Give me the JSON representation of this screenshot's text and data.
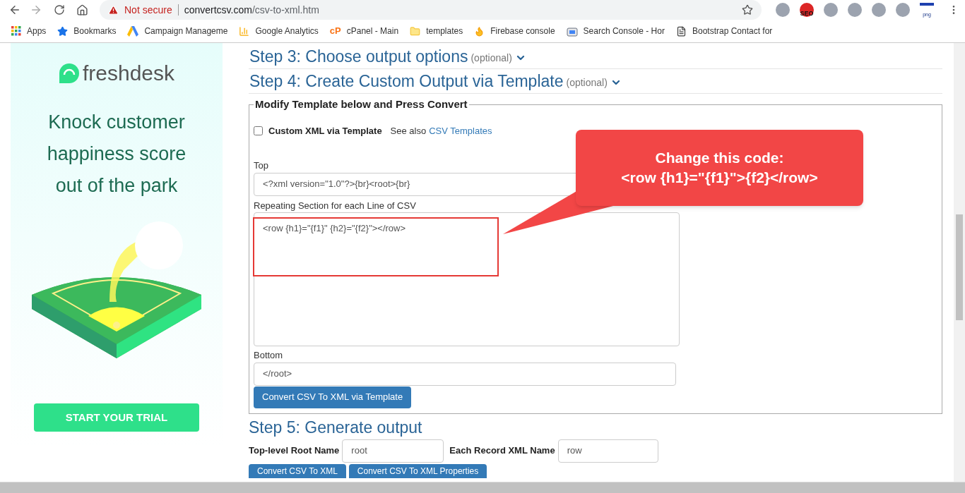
{
  "browser": {
    "url": {
      "warning": "Not secure",
      "host": "convertcsv.com",
      "path": "/csv-to-xml.htm"
    },
    "extensions": [
      {
        "kind": "plain"
      },
      {
        "kind": "seo",
        "label": "SEO"
      },
      {
        "kind": "plain"
      },
      {
        "kind": "plain"
      },
      {
        "kind": "plain"
      },
      {
        "kind": "plain"
      },
      {
        "kind": "png",
        "label": "png"
      }
    ],
    "bookmarks": [
      {
        "kind": "apps",
        "label": "Apps"
      },
      {
        "kind": "star",
        "label": "Bookmarks"
      },
      {
        "kind": "ads",
        "label": "Campaign Manageme"
      },
      {
        "kind": "analytics",
        "label": "Google Analytics"
      },
      {
        "kind": "cpanel",
        "label": "cPanel - Main",
        "icon_text": "cP"
      },
      {
        "kind": "folder",
        "label": "templates"
      },
      {
        "kind": "fire",
        "label": "Firebase console"
      },
      {
        "kind": "console",
        "label": "Search Console - Hor"
      },
      {
        "kind": "page",
        "label": "Bootstrap Contact for"
      }
    ]
  },
  "ad": {
    "brand": "freshdesk",
    "headline": [
      "Knock customer",
      "happiness score",
      "out of the park"
    ],
    "cta": "START YOUR TRIAL"
  },
  "steps": [
    {
      "title": "Step 3: Choose output options",
      "note": "(optional)"
    },
    {
      "title": "Step 4: Create Custom Output via Template",
      "note": "(optional)"
    }
  ],
  "template": {
    "legend": "Modify Template below and Press Convert",
    "checkbox": {
      "label": "Custom XML via Template",
      "checked": false
    },
    "see_also": "See also",
    "link": "CSV Templates",
    "top": {
      "label": "Top",
      "value": "<?xml version=\"1.0\"?>{br}<root>{br}"
    },
    "repeating": {
      "label": "Repeating Section for each Line of CSV",
      "value": "<row {h1}=\"{f1}\" {h2}=\"{f2}\"></row>"
    },
    "bottom": {
      "label": "Bottom",
      "value": "</root>"
    },
    "button": "Convert CSV To XML via Template"
  },
  "callout": {
    "lines": [
      "Change this code:",
      "<row {h1}=\"{f1}\">{f2}</row>"
    ]
  },
  "step5": {
    "title": "Step 5: Generate output",
    "root": {
      "label": "Top-level Root Name",
      "value": "root"
    },
    "record": {
      "label": "Each Record XML Name",
      "value": "row"
    },
    "buttons": [
      "Convert CSV To XML",
      "Convert CSV To XML Properties"
    ]
  }
}
